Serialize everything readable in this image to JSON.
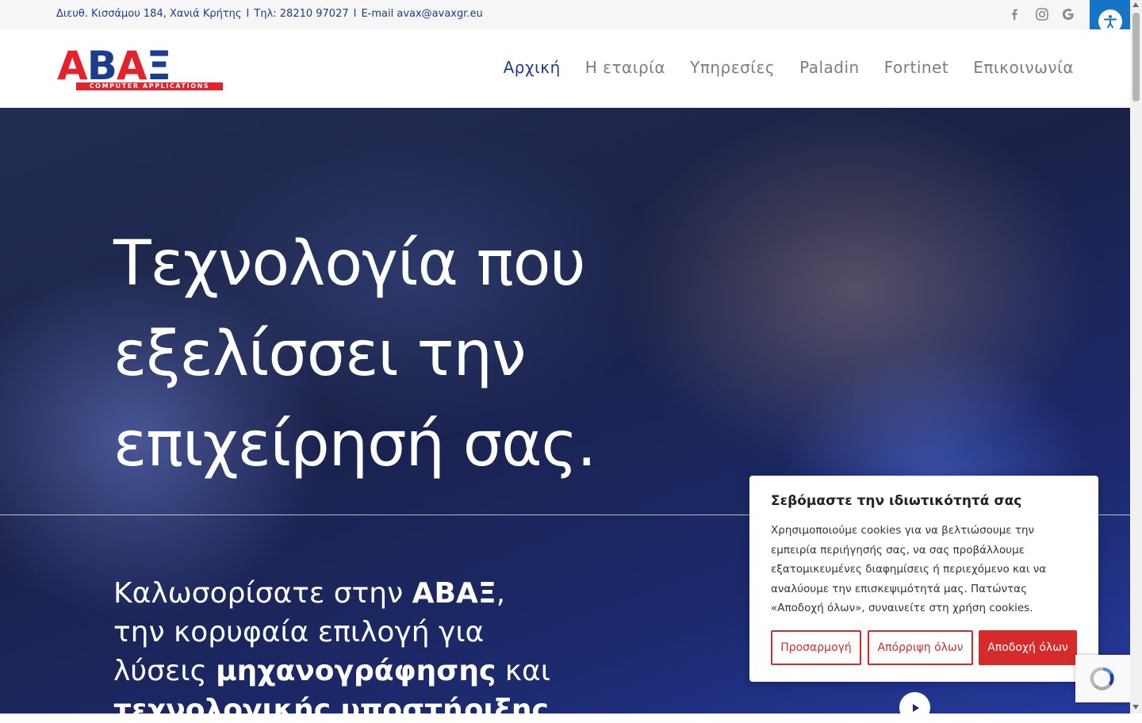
{
  "topbar": {
    "address": "Διευθ. Κισσάμου 184, Χανιά Κρήτης",
    "separator": "I",
    "phone": "Τηλ: 28210 97027",
    "email": "E-mail avax@avaxgr.eu",
    "social_icons": [
      "facebook-icon",
      "instagram-icon",
      "google-icon"
    ]
  },
  "logo": {
    "letters": [
      "Α",
      "Β",
      "Α",
      "Ξ"
    ],
    "subtitle": "COMPUTER APPLICATIONS"
  },
  "nav": {
    "items": [
      {
        "label": "Αρχική",
        "active": true
      },
      {
        "label": "Η εταιρία",
        "active": false
      },
      {
        "label": "Υπηρεσίες",
        "active": false
      },
      {
        "label": "Paladin",
        "active": false
      },
      {
        "label": "Fortinet",
        "active": false
      },
      {
        "label": "Επικοινωνία",
        "active": false
      }
    ]
  },
  "hero": {
    "headline": [
      "Τεχνολογία που",
      "εξελίσσει την",
      "επιχείρησή σας."
    ],
    "welcome": {
      "p1": "Καλωσορίσατε στην ",
      "b1": "ΑΒΑΞ",
      "p2": ",",
      "p3": "την κορυφαία επιλογή για",
      "p4": "λύσεις ",
      "b2": "μηχανογράφησης",
      "p5": " και",
      "b3": "τεχνολογικής υποστήριξης"
    }
  },
  "cookie": {
    "title": "Σεβόμαστε την ιδιωτικότητά σας",
    "text": "Χρησιμοποιούμε cookies για να βελτιώσουμε την εμπειρία περιήγησής σας, να σας προβάλλουμε εξατομικευμένες διαφημίσεις ή περιεχόμενο και να αναλύουμε την επισκεψιμότητά μας. Πατώντας «Αποδοχή όλων», συναινείτε στη χρήση cookies.",
    "customize": "Προσαρμογή",
    "reject": "Απόρριψη όλων",
    "accept": "Αποδοχή όλων"
  },
  "colors": {
    "brand_blue": "#1f3a8f",
    "brand_red": "#e4222b",
    "cookie_red": "#d62b2b",
    "accessibility_blue": "#1674c6"
  }
}
